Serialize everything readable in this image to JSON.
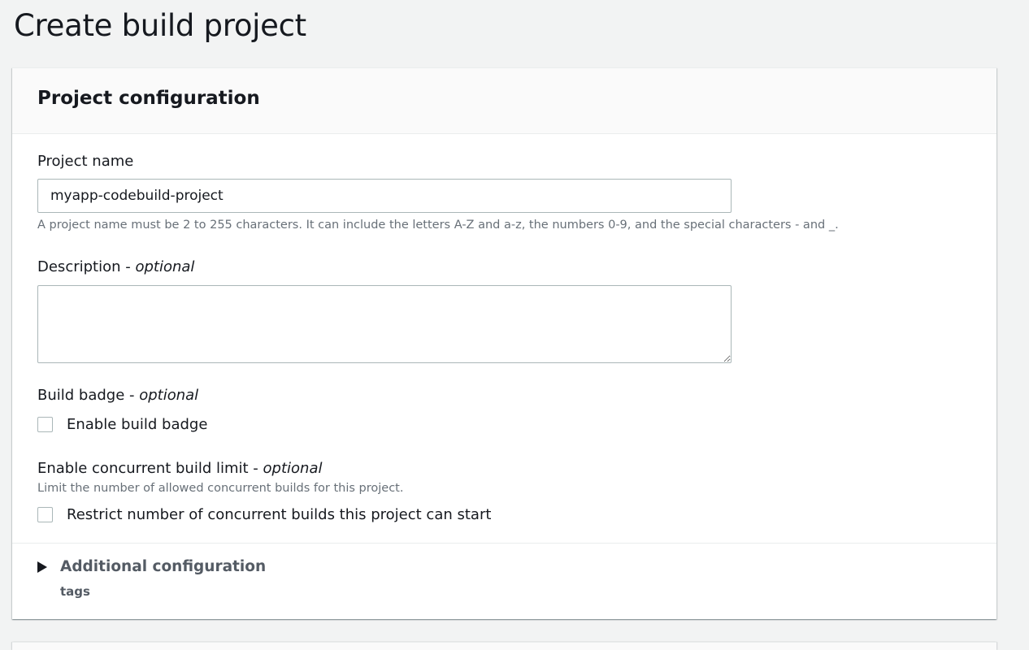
{
  "page": {
    "title": "Create build project"
  },
  "project_configuration": {
    "title": "Project configuration",
    "project_name": {
      "label": "Project name",
      "value": "myapp-codebuild-project",
      "hint": "A project name must be 2 to 255 characters. It can include the letters A-Z and a-z, the numbers 0-9, and the special characters - and _."
    },
    "description": {
      "label": "Description - ",
      "optional": "optional",
      "value": ""
    },
    "build_badge": {
      "label": "Build badge - ",
      "optional": "optional",
      "checkbox_label": "Enable build badge",
      "checked": false
    },
    "concurrent_limit": {
      "label": "Enable concurrent build limit - ",
      "optional": "optional",
      "hint": "Limit the number of allowed concurrent builds for this project.",
      "checkbox_label": "Restrict number of concurrent builds this project can start",
      "checked": false
    },
    "additional_configuration": {
      "title": "Additional configuration",
      "subtitle": "tags",
      "expanded": false
    }
  },
  "colors": {
    "background": "#f2f3f3",
    "panel_header": "#fafafa",
    "border": "#aab7b8",
    "hint_text": "#687078",
    "muted_heading": "#545b64"
  }
}
